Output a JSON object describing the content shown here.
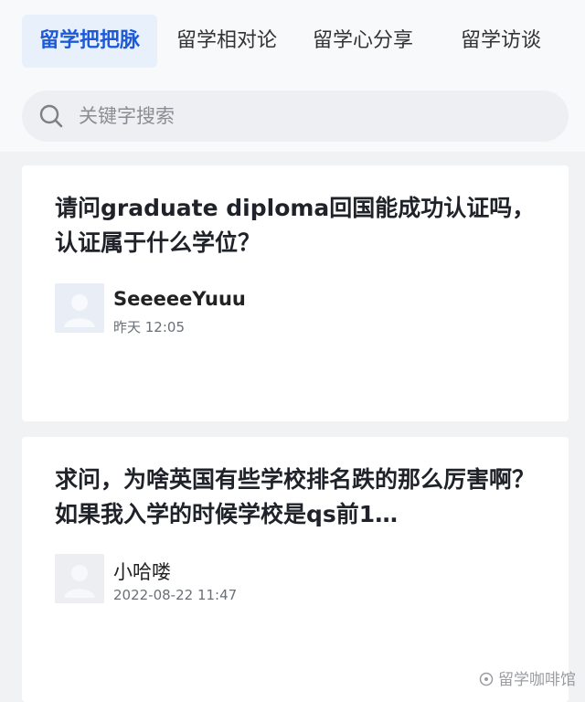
{
  "tabs": [
    {
      "label": "留学把把脉",
      "active": true
    },
    {
      "label": "留学相对论",
      "active": false
    },
    {
      "label": "留学心分享",
      "active": false
    },
    {
      "label": "留学访谈",
      "active": false
    }
  ],
  "search": {
    "placeholder": "关键字搜索",
    "icon": "search-icon"
  },
  "posts": [
    {
      "title": "请问graduate diploma回国能成功认证吗，认证属于什么学位？",
      "author": "SeeeeeYuuu",
      "time": "昨天 12:05"
    },
    {
      "title": "求问，为啥英国有些学校排名跌的那么厉害啊？如果我入学的时候学校是qs前1…",
      "author": "小哈喽",
      "time": "2022-08-22 11:47"
    }
  ],
  "watermark": "留学咖啡馆",
  "colors": {
    "accent": "#1d5ad8",
    "active_tab_bg": "#e8f0fc",
    "page_bg": "#f1f2f4",
    "card_bg": "#ffffff",
    "avatar_bg": "#e9edf6"
  }
}
